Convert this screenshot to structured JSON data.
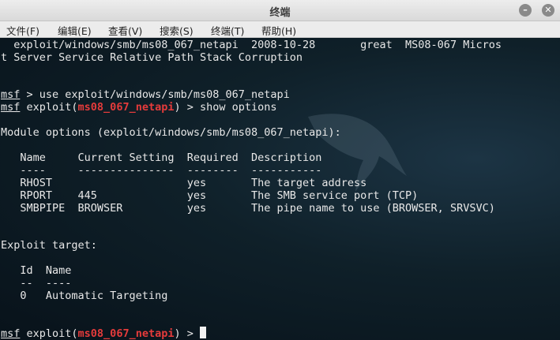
{
  "window": {
    "title": "终端"
  },
  "menu": [
    "文件(F)",
    "编辑(E)",
    "查看(V)",
    "搜索(S)",
    "终端(T)",
    "帮助(H)"
  ],
  "prompt_word": "msf",
  "module_name": "ms08_067_netapi",
  "terminal": {
    "l1": "  exploit/windows/smb/ms08_067_netapi  2008-10-28       great  MS08-067 Micros",
    "l2": "t Server Service Relative Path Stack Corruption",
    "use_cmd": " > use exploit/windows/smb/ms08_067_netapi",
    "exploit_open": " exploit(",
    "show_cmd": ") > show options",
    "prompt_end": ") > ",
    "mod_opts": "Module options (exploit/windows/smb/ms08_067_netapi):",
    "hdr": "   Name     Current Setting  Required  Description",
    "sep": "   ----     ---------------  --------  -----------",
    "r1": "   RHOST                     yes       The target address",
    "r2": "   RPORT    445              yes       The SMB service port (TCP)",
    "r3": "   SMBPIPE  BROWSER          yes       The pipe name to use (BROWSER, SRVSVC)",
    "target_title": "Exploit target:",
    "t_hdr": "   Id  Name",
    "t_sep": "   --  ----",
    "t_r1": "   0   Automatic Targeting"
  }
}
